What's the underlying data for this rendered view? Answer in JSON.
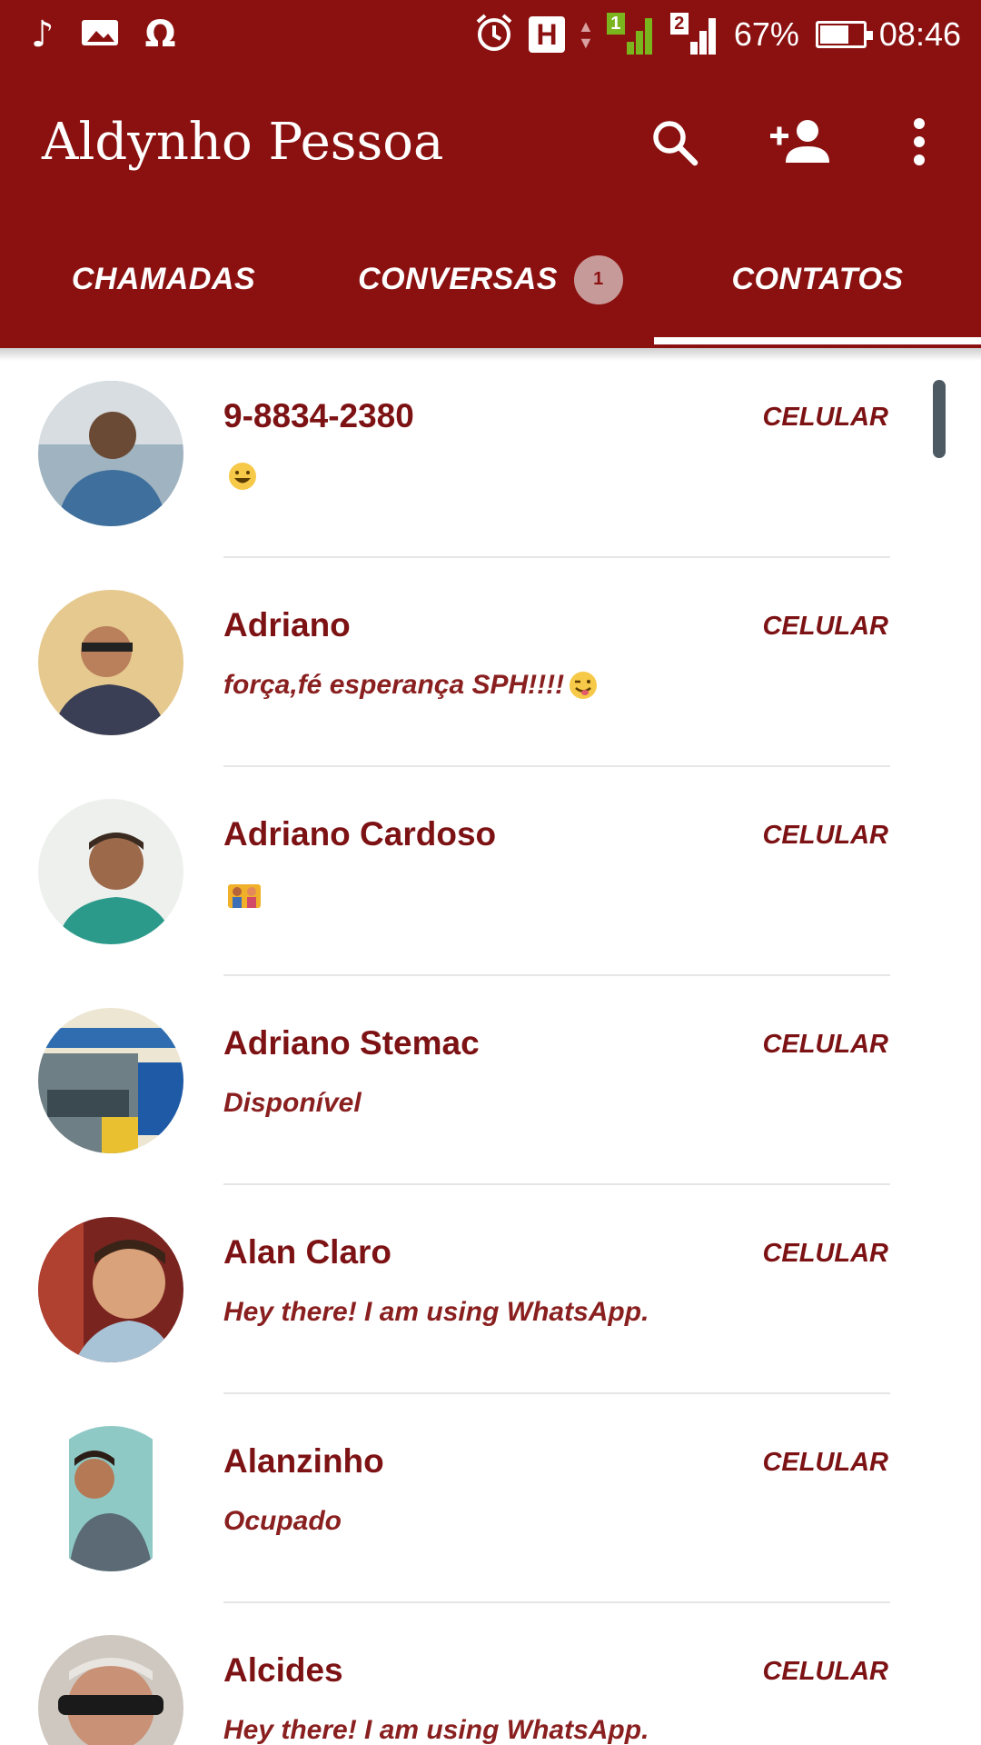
{
  "status_bar": {
    "left_icons": [
      "music-note-icon",
      "image-icon",
      "headphones-icon"
    ],
    "right_icons": [
      "alarm-icon",
      "network-h-icon",
      "sim1-signal-icon",
      "sim2-signal-icon",
      "battery-icon"
    ],
    "sim1_label": "1",
    "sim2_label": "2",
    "network_label": "H",
    "battery_percent": "67%",
    "battery_level": 0.67,
    "time": "08:46"
  },
  "app_bar": {
    "title": "Aldynho Pessoa",
    "actions": [
      "search-icon",
      "add-contact-icon",
      "overflow-menu-icon"
    ]
  },
  "tabs": [
    {
      "label": "CHAMADAS",
      "active": false
    },
    {
      "label": "CONVERSAS",
      "active": false,
      "badge": "1"
    },
    {
      "label": "CONTATOS",
      "active": true
    }
  ],
  "contacts": [
    {
      "name": "9-8834-2380",
      "type": "CELULAR",
      "status": "",
      "status_emoji": "grinning-emoji",
      "avatar": "contact-photo"
    },
    {
      "name": "Adriano",
      "type": "CELULAR",
      "status": "força,fé esperança SPH!!!!",
      "status_emoji": "winking-tongue-emoji",
      "avatar": "contact-photo"
    },
    {
      "name": "Adriano Cardoso",
      "type": "CELULAR",
      "status": "",
      "status_emoji": "family-emoji",
      "avatar": "contact-photo"
    },
    {
      "name": "Adriano Stemac",
      "type": "CELULAR",
      "status": "Disponível",
      "status_emoji": "",
      "avatar": "contact-photo"
    },
    {
      "name": "Alan Claro",
      "type": "CELULAR",
      "status": "Hey there! I am using WhatsApp.",
      "status_emoji": "",
      "avatar": "contact-photo"
    },
    {
      "name": "Alanzinho",
      "type": "CELULAR",
      "status": "Ocupado",
      "status_emoji": "",
      "avatar": "contact-photo"
    },
    {
      "name": "Alcides",
      "type": "CELULAR",
      "status": "Hey there! I am using WhatsApp.",
      "status_emoji": "",
      "avatar": "contact-photo"
    }
  ],
  "colors": {
    "brand": "#8b1111",
    "text_primary": "#7d1214",
    "tab_indicator": "#ffffff",
    "badge_bg": "#c79a9a",
    "divider": "#e6e6e6",
    "scrollbar": "#4d5a63"
  }
}
